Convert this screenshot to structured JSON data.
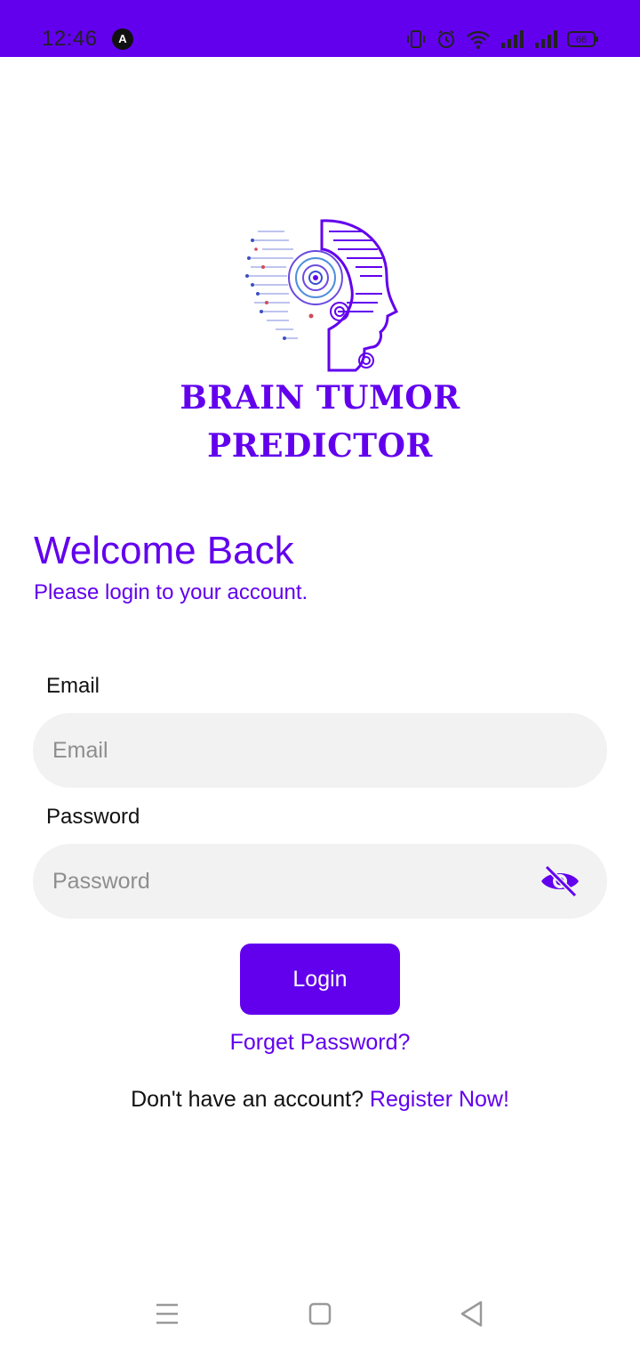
{
  "status_bar": {
    "time": "12:46",
    "app_badge": "A",
    "battery": "66",
    "icons": [
      "vibrate-icon",
      "alarm-icon",
      "wifi-icon",
      "signal-icon",
      "signal-icon",
      "battery-icon"
    ]
  },
  "brand": {
    "line1": "BRAIN TUMOR",
    "line2": "PREDICTOR"
  },
  "header": {
    "title": "Welcome Back",
    "subtitle": "Please login to your account."
  },
  "form": {
    "email_label": "Email",
    "email_placeholder": "Email",
    "email_value": "",
    "password_label": "Password",
    "password_placeholder": "Password",
    "password_value": ""
  },
  "actions": {
    "login_label": "Login",
    "forgot_label": "Forget Password?",
    "register_prompt": "Don't have an account?",
    "register_link": "Register Now!"
  },
  "colors": {
    "accent": "#6200ee",
    "field_bg": "#f2f2f2"
  }
}
